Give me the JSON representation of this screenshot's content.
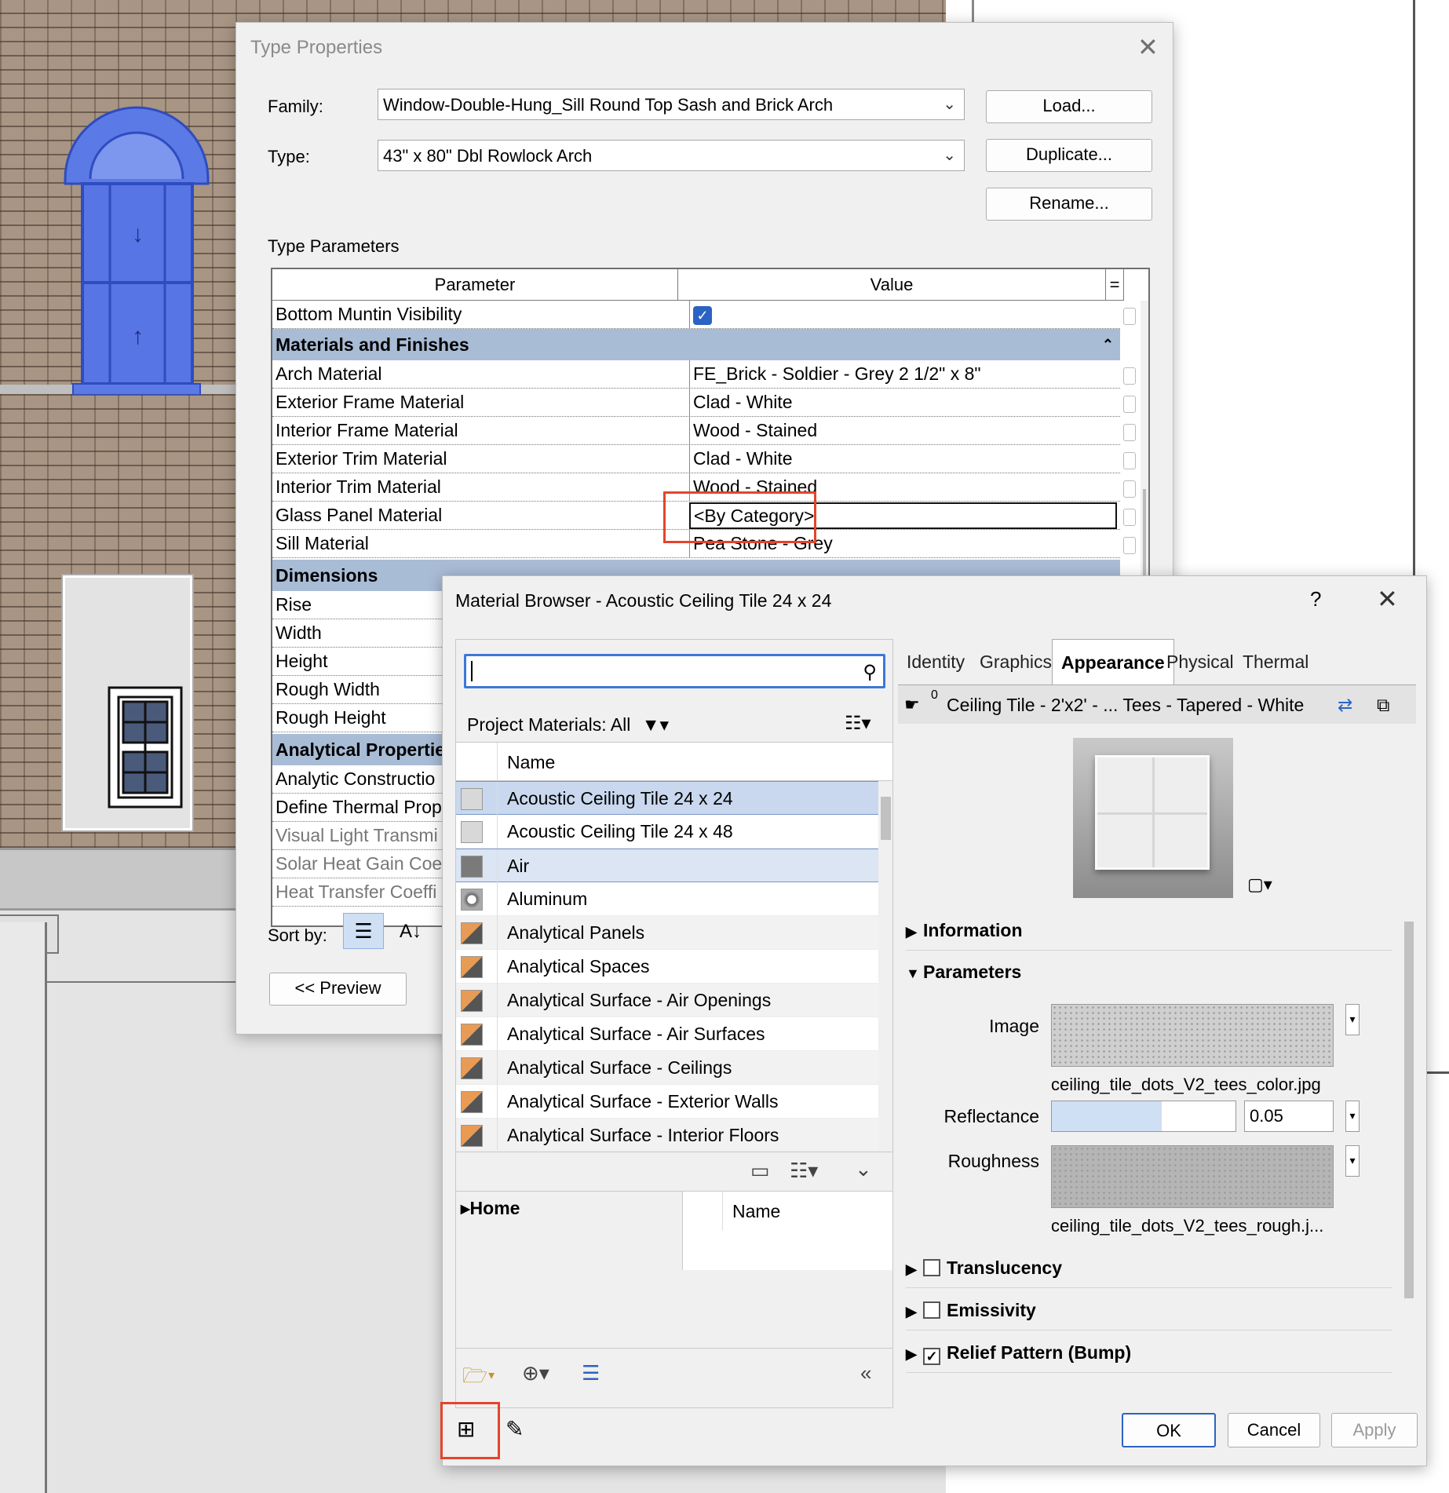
{
  "type_properties": {
    "title": "Type Properties",
    "family_label": "Family:",
    "family_value": "Window-Double-Hung_Sill Round Top Sash and  Brick Arch",
    "type_label": "Type:",
    "type_value": "43\" x 80\" Dbl Rowlock Arch",
    "load_button": "Load...",
    "duplicate_button": "Duplicate...",
    "rename_button": "Rename...",
    "type_parameters_label": "Type Parameters",
    "col_parameter": "Parameter",
    "col_value": "Value",
    "col_eq": "=",
    "rows": {
      "bottom_muntin": "Bottom Muntin Visibility",
      "grp_materials": "Materials and Finishes",
      "arch_material": {
        "p": "Arch Material",
        "v": "FE_Brick - Soldier - Grey 2 1/2\" x 8\""
      },
      "ext_frame": {
        "p": "Exterior Frame Material",
        "v": "Clad - White"
      },
      "int_frame": {
        "p": "Interior Frame Material",
        "v": "Wood - Stained"
      },
      "ext_trim": {
        "p": "Exterior Trim Material",
        "v": "Clad - White"
      },
      "int_trim": {
        "p": "Interior Trim Material",
        "v": "Wood - Stained"
      },
      "glass_panel": {
        "p": "Glass Panel Material",
        "v": "<By Category>"
      },
      "sill": {
        "p": "Sill Material",
        "v": "Pea Stone - Grey"
      },
      "grp_dimensions": "Dimensions",
      "rise": "Rise",
      "width": "Width",
      "height": "Height",
      "rough_width": "Rough Width",
      "rough_height": "Rough Height",
      "grp_analytical": "Analytical Propertie",
      "analytic_construction": "Analytic Constructio",
      "define_thermal": "Define Thermal Prop",
      "visual_light": "Visual Light Transmi",
      "solar_heat": "Solar Heat Gain Coe",
      "heat_transfer": "Heat Transfer Coeffi"
    },
    "sort_by_label": "Sort by:",
    "preview_button": "<< Preview"
  },
  "material_browser": {
    "title": "Material Browser - Acoustic Ceiling Tile 24 x 24",
    "help": "?",
    "search_placeholder": "",
    "filter_label": "Project Materials: All",
    "list_header": "Name",
    "materials": [
      "Acoustic Ceiling Tile 24 x 24",
      "Acoustic Ceiling Tile 24 x 48",
      "Air",
      "Aluminum",
      "Analytical Panels",
      "Analytical Spaces",
      "Analytical Surface - Air Openings",
      "Analytical Surface - Air Surfaces",
      "Analytical Surface - Ceilings",
      "Analytical Surface - Exterior Walls",
      "Analytical Surface - Interior Floors"
    ],
    "library_home": "Home",
    "library_name_header": "Name",
    "tabs": [
      "Identity",
      "Graphics",
      "Appearance",
      "Physical",
      "Thermal"
    ],
    "active_tab": "Appearance",
    "asset_count": "0",
    "asset_name": "Ceiling Tile - 2'x2' - ... Tees - Tapered - White",
    "sections": {
      "information": "Information",
      "parameters": "Parameters",
      "translucency": "Translucency",
      "emissivity": "Emissivity",
      "relief": "Relief Pattern (Bump)"
    },
    "image_label": "Image",
    "image_file": "ceiling_tile_dots_V2_tees_color.jpg",
    "reflectance_label": "Reflectance",
    "reflectance_value": "0.05",
    "reflectance_fraction": 0.6,
    "roughness_label": "Roughness",
    "roughness_file": "ceiling_tile_dots_V2_tees_rough.j...",
    "ok_button": "OK",
    "cancel_button": "Cancel",
    "apply_button": "Apply"
  },
  "colors": {
    "highlight_box": "#e3452b",
    "group_header": "#a9bcd6",
    "selection": "#c9d8ee",
    "window_blue": "#4d6fe0"
  }
}
